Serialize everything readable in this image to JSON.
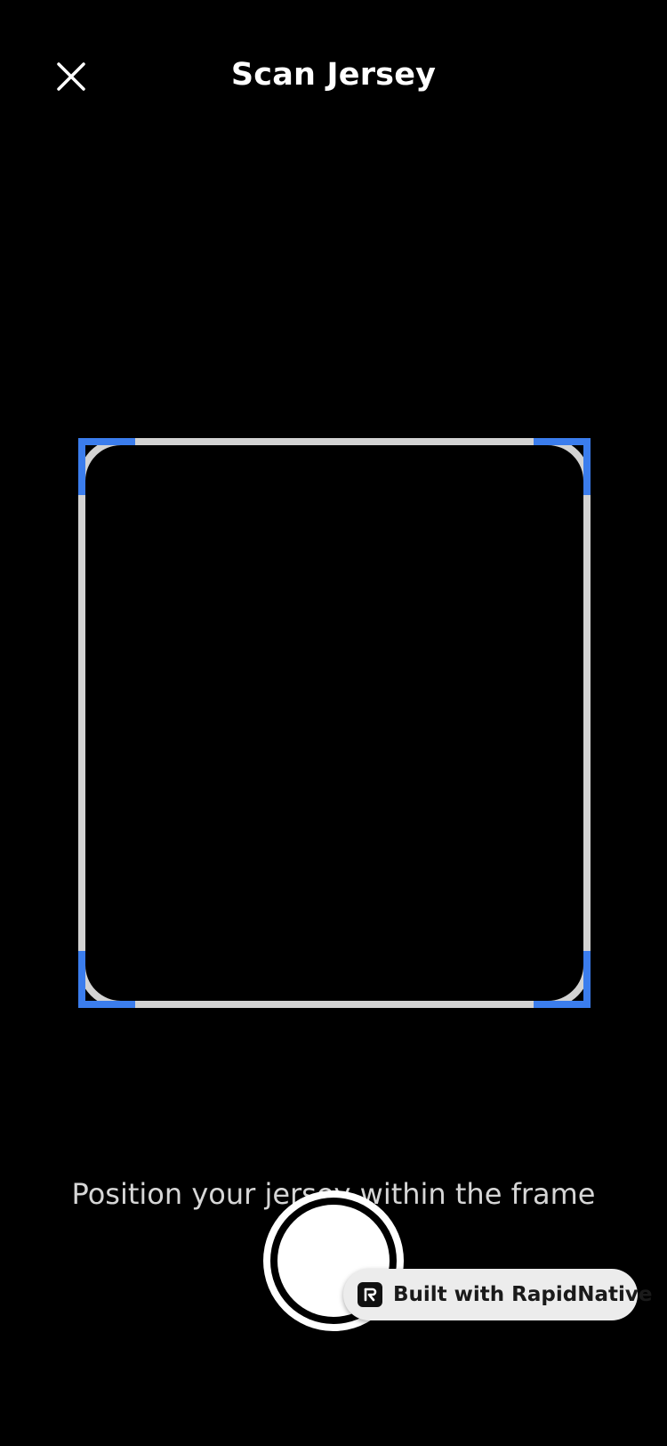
{
  "header": {
    "title": "Scan Jersey",
    "close_icon": "close-icon"
  },
  "scanner": {
    "frame_color": "#d3d3d3",
    "corner_color": "#3b7ded",
    "hint": "Position your jersey within the frame"
  },
  "capture": {
    "shutter_icon": "shutter-button"
  },
  "badge": {
    "label": "Built with RapidNative",
    "logo_icon": "rapidnative-logo-icon"
  }
}
